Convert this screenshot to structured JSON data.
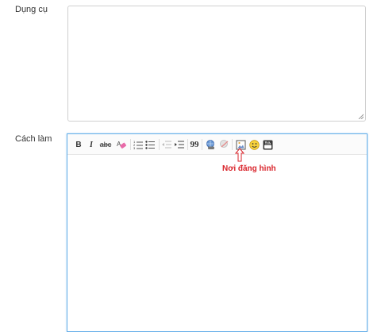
{
  "form": {
    "field_tools_label": "Dụng cụ",
    "field_method_label": "Cách làm"
  },
  "editor": {
    "toolbar": {
      "bold": "B",
      "italic": "I",
      "strike": "abc",
      "quote": "99"
    },
    "annotation": "Nơi đăng hình"
  },
  "colors": {
    "focus_border": "#66afe9",
    "annotation": "#d9232a"
  }
}
